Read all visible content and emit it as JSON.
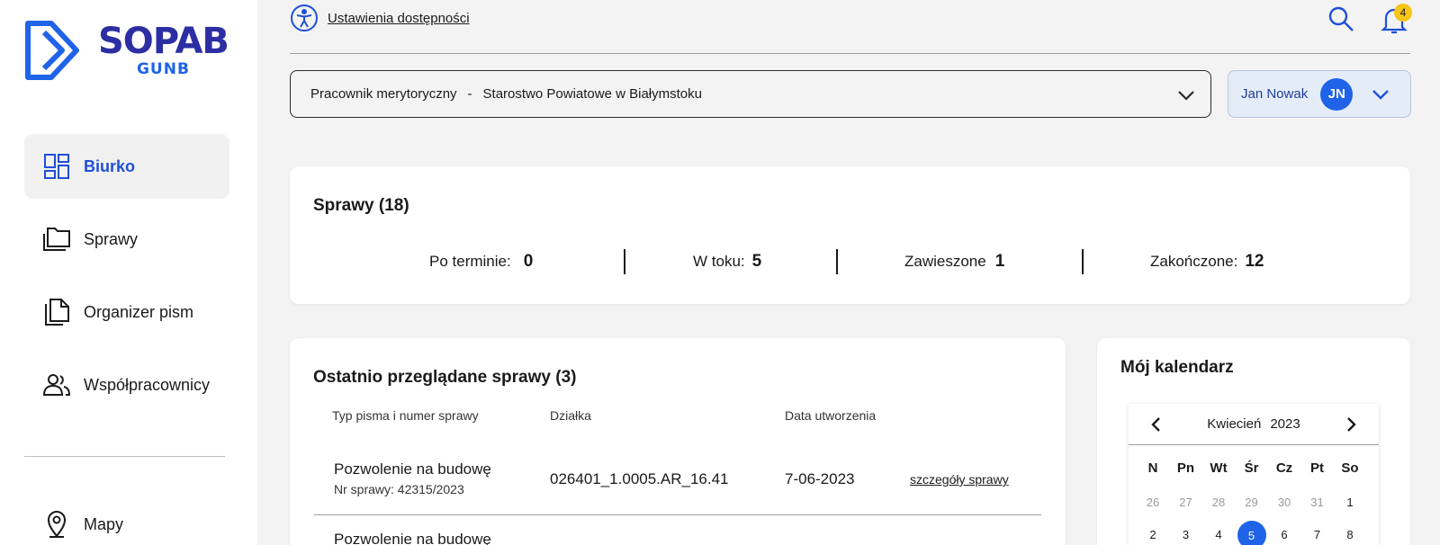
{
  "brand": {
    "title": "SOPAB",
    "subtitle": "GUNB",
    "primary_color": "#2c2ea3",
    "accent_color": "#1f63e8"
  },
  "sidebar": {
    "items": [
      {
        "label": "Biurko",
        "icon": "dashboard-icon",
        "active": true
      },
      {
        "label": "Sprawy",
        "icon": "folder-icon",
        "active": false
      },
      {
        "label": "Organizer pism",
        "icon": "documents-icon",
        "active": false
      },
      {
        "label": "Współpracownicy",
        "icon": "people-icon",
        "active": false
      },
      {
        "label": "Mapy",
        "icon": "map-pin-icon",
        "active": false
      }
    ]
  },
  "topbar": {
    "accessibility_label": "Ustawienia dostępności",
    "notifications_count": "4"
  },
  "role_select": {
    "role": "Pracownik merytoryczny",
    "separator": "-",
    "office": "Starostwo Powiatowe w Białymstoku"
  },
  "user": {
    "name": "Jan Nowak",
    "initials": "JN"
  },
  "summary": {
    "title": "Sprawy (18)",
    "stats": [
      {
        "label": "Po terminie:",
        "value": "0"
      },
      {
        "label": "W toku:",
        "value": "5"
      },
      {
        "label": "Zawieszone",
        "value": "1"
      },
      {
        "label": "Zakończone:",
        "value": "12"
      }
    ]
  },
  "recent": {
    "title": "Ostatnio przeglądane sprawy (3)",
    "columns": [
      "Typ pisma i numer sprawy",
      "Działka",
      "Data utworzenia"
    ],
    "rows": [
      {
        "name": "Pozwolenie na budowę",
        "number": "Nr sprawy: 42315/2023",
        "plot": "026401_1.0005.AR_16.41",
        "date": "7-06-2023",
        "link": "szczegóły sprawy"
      },
      {
        "name": "Pozwolenie na budowę"
      }
    ]
  },
  "calendar": {
    "title": "Mój kalendarz",
    "month": "Kwiecień",
    "year": "2023",
    "weekdays": [
      "N",
      "Pn",
      "Wt",
      "Śr",
      "Cz",
      "Pt",
      "So"
    ],
    "week1": [
      "26",
      "27",
      "28",
      "29",
      "30",
      "31",
      "1"
    ],
    "week2": [
      "2",
      "3",
      "4",
      "5",
      "6",
      "7",
      "8"
    ],
    "today": "5"
  }
}
